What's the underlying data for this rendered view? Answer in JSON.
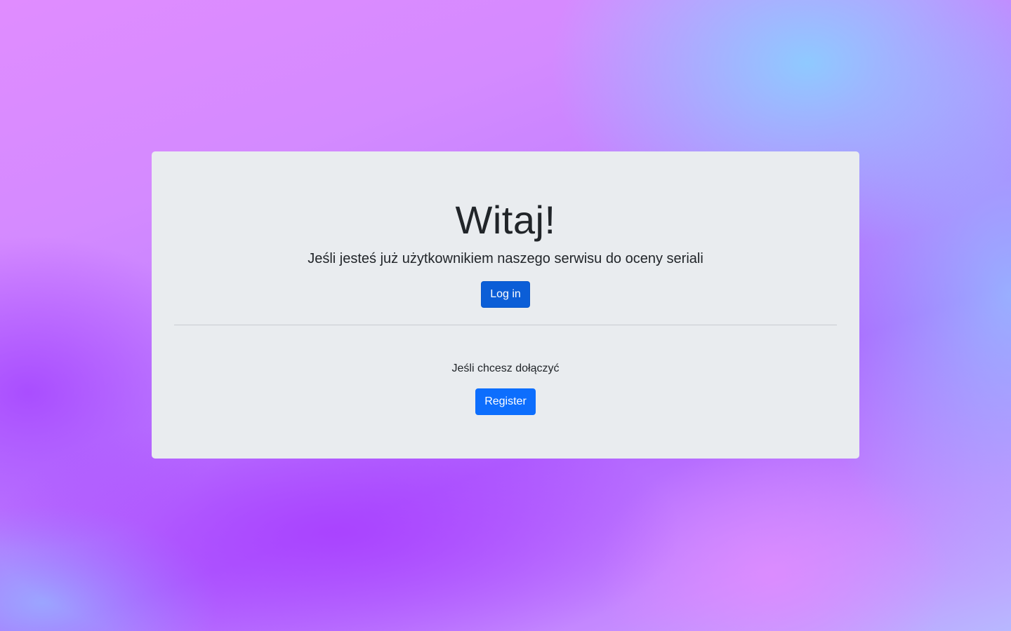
{
  "hero": {
    "title": "Witaj!",
    "lead": "Jeśli jesteś już użytkownikiem naszego serwisu do oceny seriali",
    "login_label": "Log in",
    "join_text": "Jeśli chcesz dołączyć",
    "register_label": "Register"
  },
  "colors": {
    "card_background": "#e9ecef",
    "login_button": "#0b5ed7",
    "register_button": "#0d6efd",
    "text": "#212529"
  }
}
